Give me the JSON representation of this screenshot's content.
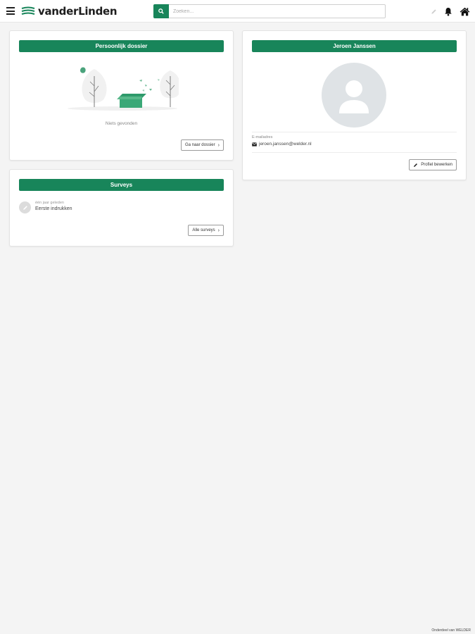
{
  "header": {
    "brand": "vanderLinden",
    "search_placeholder": "Zoeken..."
  },
  "dossier": {
    "title": "Persoonlijk dossier",
    "empty_text": "Niets gevonden",
    "button_label": "Ga naar dossier"
  },
  "surveys": {
    "title": "Surveys",
    "items": [
      {
        "time": "één jaar geleden",
        "title": "Eerste indrukken"
      }
    ],
    "button_label": "Alle surveys"
  },
  "profile": {
    "name": "Jeroen Janssen",
    "email_label": "E-mailadres",
    "email": "jeroen.janssen@welder.nl",
    "button_label": "Profiel bewerken"
  },
  "footer": {
    "text": "Onderdeel van WELDER"
  },
  "colors": {
    "accent": "#18855a",
    "background": "#f4f4f4",
    "avatar_bg": "#dfe3e6"
  },
  "icons": [
    "menu-icon",
    "search-icon",
    "pencil-icon",
    "bell-icon",
    "home-icon",
    "envelope-icon",
    "chevron-right-icon",
    "user-icon"
  ]
}
